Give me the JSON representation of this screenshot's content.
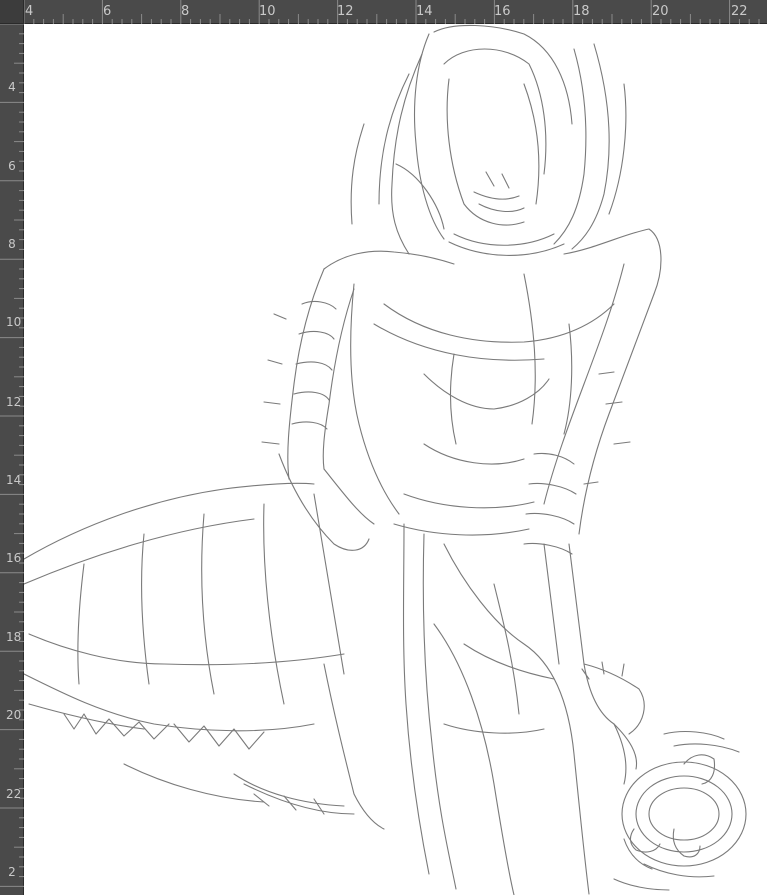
{
  "rulers": {
    "unit_note": "",
    "horizontal_labels": [
      "4",
      "6",
      "8",
      "10",
      "12",
      "14",
      "16",
      "18",
      "20",
      "22"
    ],
    "vertical_labels": [
      "4",
      "6",
      "8",
      "10",
      "12",
      "14",
      "16",
      "18",
      "20",
      "22",
      "2"
    ]
  },
  "canvas": {
    "content": "pencil-sketch",
    "subject": "kneeling armored figure with long hair and a ring of chain on the ground"
  },
  "colors": {
    "ruler_bg": "#4a4a4a",
    "ruler_text": "#c9c9c9",
    "canvas_bg": "#ffffff",
    "sketch_stroke": "#7a7a7a"
  }
}
